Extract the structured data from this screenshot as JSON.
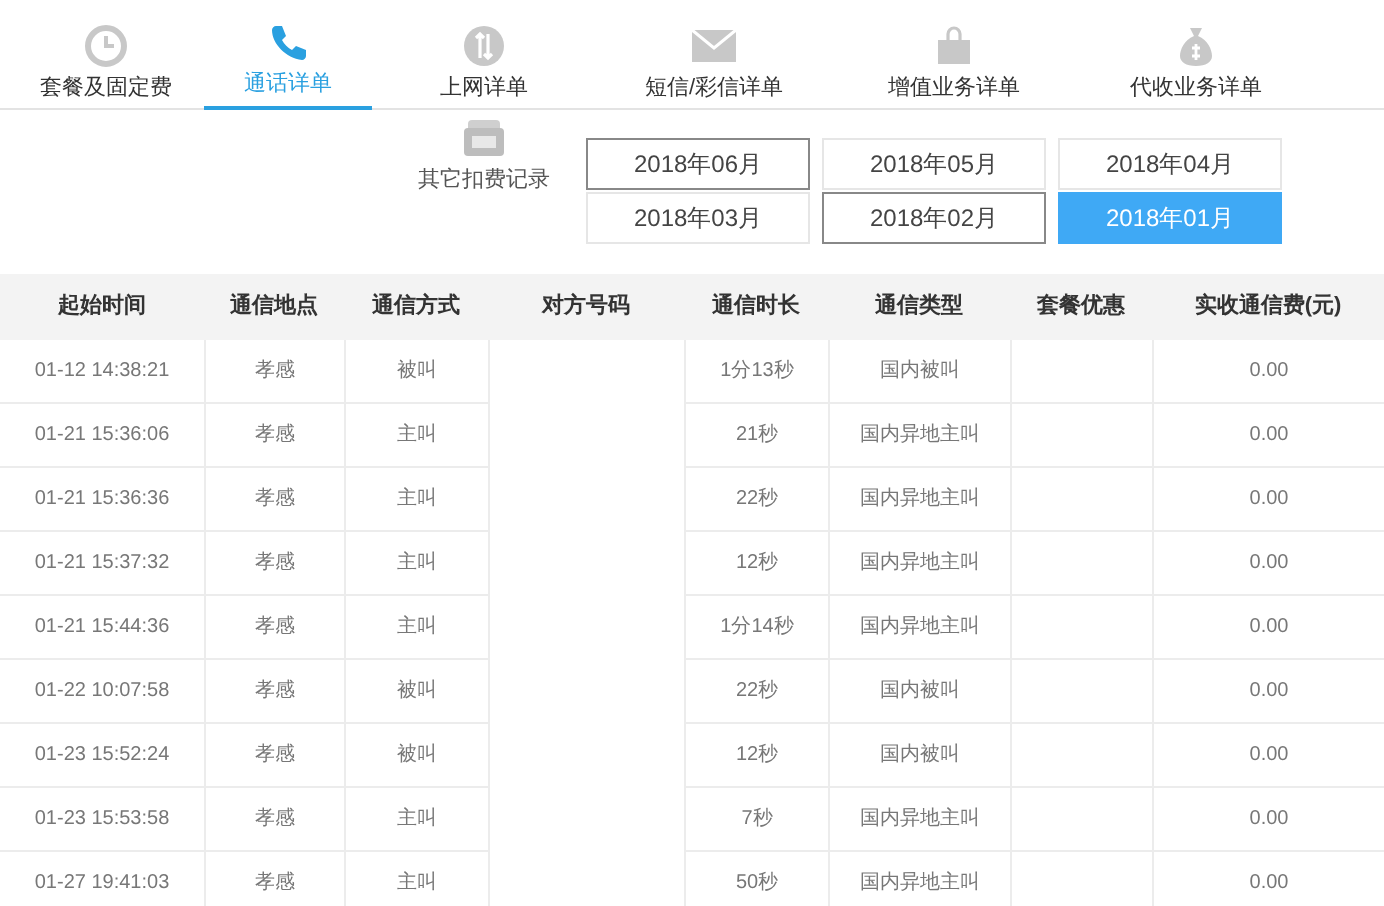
{
  "tabs": [
    {
      "label": "套餐及固定费",
      "selected": false
    },
    {
      "label": "通话详单",
      "selected": true
    },
    {
      "label": "上网详单",
      "selected": false
    },
    {
      "label": "短信/彩信详单",
      "selected": false
    },
    {
      "label": "增值业务详单",
      "selected": false
    },
    {
      "label": "代收业务详单",
      "selected": false
    }
  ],
  "other_charges": {
    "label": "其它扣费记录"
  },
  "months": [
    {
      "label": "2018年06月",
      "selected": false,
      "outlined": true
    },
    {
      "label": "2018年05月",
      "selected": false,
      "outlined": false
    },
    {
      "label": "2018年04月",
      "selected": false,
      "outlined": false
    },
    {
      "label": "2018年03月",
      "selected": false,
      "outlined": false
    },
    {
      "label": "2018年02月",
      "selected": false,
      "outlined": true
    },
    {
      "label": "2018年01月",
      "selected": true,
      "outlined": false
    }
  ],
  "table": {
    "columns": [
      "起始时间",
      "通信地点",
      "通信方式",
      "对方号码",
      "通信时长",
      "通信类型",
      "套餐优惠",
      "实收通信费(元)"
    ],
    "rows": [
      {
        "start_time": "01-12 14:38:21",
        "location": "孝感",
        "call_mode": "被叫",
        "duration": "1分13秒",
        "call_type": "国内被叫",
        "charge": "0.00"
      },
      {
        "start_time": "01-21 15:36:06",
        "location": "孝感",
        "call_mode": "主叫",
        "duration": "21秒",
        "call_type": "国内异地主叫",
        "charge": "0.00"
      },
      {
        "start_time": "01-21 15:36:36",
        "location": "孝感",
        "call_mode": "主叫",
        "duration": "22秒",
        "call_type": "国内异地主叫",
        "charge": "0.00"
      },
      {
        "start_time": "01-21 15:37:32",
        "location": "孝感",
        "call_mode": "主叫",
        "duration": "12秒",
        "call_type": "国内异地主叫",
        "charge": "0.00"
      },
      {
        "start_time": "01-21 15:44:36",
        "location": "孝感",
        "call_mode": "主叫",
        "duration": "1分14秒",
        "call_type": "国内异地主叫",
        "charge": "0.00"
      },
      {
        "start_time": "01-22 10:07:58",
        "location": "孝感",
        "call_mode": "被叫",
        "duration": "22秒",
        "call_type": "国内被叫",
        "charge": "0.00"
      },
      {
        "start_time": "01-23 15:52:24",
        "location": "孝感",
        "call_mode": "被叫",
        "duration": "12秒",
        "call_type": "国内被叫",
        "charge": "0.00"
      },
      {
        "start_time": "01-23 15:53:58",
        "location": "孝感",
        "call_mode": "主叫",
        "duration": "7秒",
        "call_type": "国内异地主叫",
        "charge": "0.00"
      },
      {
        "start_time": "01-27 19:41:03",
        "location": "孝感",
        "call_mode": "主叫",
        "duration": "50秒",
        "call_type": "国内异地主叫",
        "charge": "0.00"
      }
    ]
  }
}
